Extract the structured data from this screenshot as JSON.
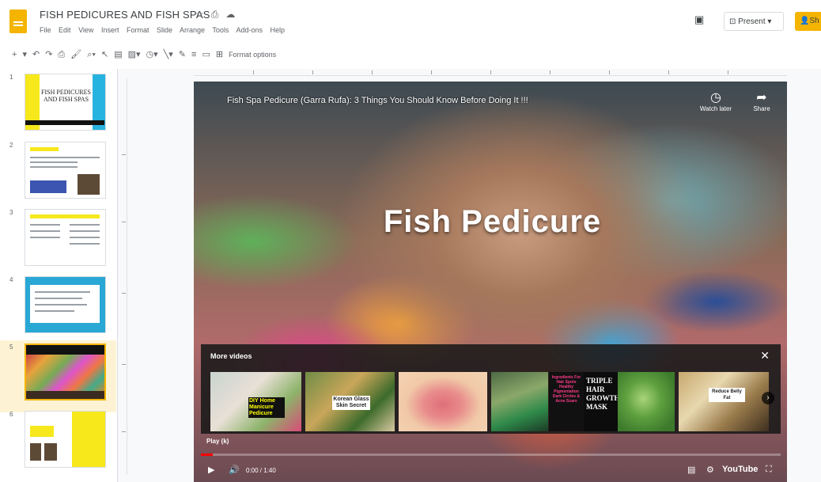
{
  "document": {
    "title": "FISH PEDICURES AND FISH SPAS",
    "title_icons": [
      "star-icon",
      "move-icon",
      "cloud-icon"
    ]
  },
  "menu": [
    "File",
    "Edit",
    "View",
    "Insert",
    "Format",
    "Slide",
    "Arrange",
    "Tools",
    "Add-ons",
    "Help"
  ],
  "header": {
    "present_label": "Present",
    "share_label": "Sh"
  },
  "toolbar": {
    "format_options_label": "Format options"
  },
  "filmstrip": {
    "slides": [
      {
        "number": "1",
        "title": "FISH PEDICURES AND FISH SPAS"
      },
      {
        "number": "2",
        "title": ""
      },
      {
        "number": "3",
        "title": ""
      },
      {
        "number": "4",
        "title": ""
      },
      {
        "number": "5",
        "title": ""
      },
      {
        "number": "6",
        "title": ""
      }
    ],
    "selected_slide": 5
  },
  "video": {
    "title": "Fish Spa Pedicure (Garra Rufa): 3 Things You Should Know Before Doing It !!!",
    "watch_later_label": "Watch later",
    "share_label": "Share",
    "overlay_text": "Fish Pedicure",
    "more_videos_label": "More videos",
    "playing_label": "Play (k)",
    "time": "0:00 / 1:40",
    "progress": 0.0,
    "brand": "YouTube",
    "thumbnails": [
      {
        "caption": "DIY Home Manicure Pedicure"
      },
      {
        "caption": "Korean Glass Skin Secret"
      },
      {
        "caption": ""
      },
      {
        "caption": ""
      },
      {
        "caption": "Ingredients For Hair Spots Healthy Pigmentation Dark Circles & Acne Scars"
      },
      {
        "caption": "TRIPLE HAIR GROWTH MASK"
      },
      {
        "caption": ""
      },
      {
        "caption": "Reduce Belly Fat"
      }
    ]
  },
  "colors": {
    "accent_yellow": "#f4b400",
    "slide_yellow": "#f6e81b",
    "slide_blue": "#29a8d6",
    "progress_red": "#ff0000"
  }
}
